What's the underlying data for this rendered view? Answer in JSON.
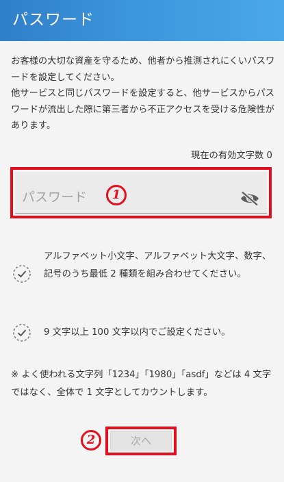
{
  "header": {
    "title": "パスワード"
  },
  "intro": {
    "line1": "お客様の大切な資産を守るため、他者から推測されにくいパスワードを設定してください。",
    "line2": "他サービスと同じパスワードを設定すると、他サービスからパスワードが流出した際に第三者から不正アクセスを受ける危険性があります。"
  },
  "counter": {
    "label": "現在の有効文字数 0"
  },
  "password": {
    "placeholder": "パスワード",
    "value": ""
  },
  "markers": {
    "m1": "1",
    "m2": "2"
  },
  "rules": [
    {
      "text": "アルファベット小文字、アルファベット大文字、数字、記号のうち最低 2 種類を組み合わせてください。"
    },
    {
      "text": "9 文字以上 100 文字以内でご設定ください。"
    }
  ],
  "note": "※ よく使われる文字列「1234」「1980」「asdf」などは 4 文字ではなく、全体で 1 文字としてカウントします。",
  "next_button": {
    "label": "次へ"
  },
  "colors": {
    "header_start": "#2f7fc8",
    "header_end": "#4aa8e8",
    "highlight": "#e2101f",
    "disabled_text": "#a8a8a8"
  }
}
